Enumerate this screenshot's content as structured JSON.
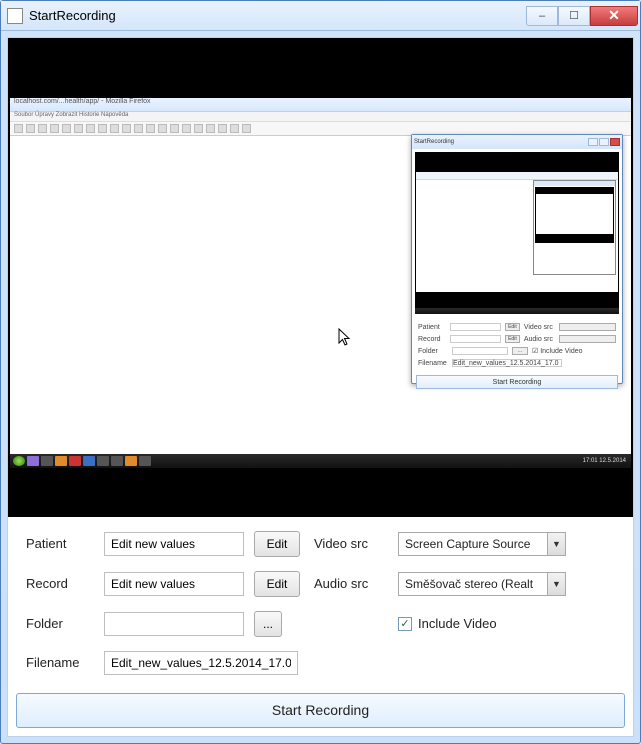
{
  "window": {
    "title": "StartRecording",
    "min_label": "–",
    "max_label": "☐",
    "close_label": "✕"
  },
  "preview": {
    "inner_title": "localhost.com/...health/app/ - Mozilla Firefox",
    "inner_menu": "Soubor  Úpravy  Zobrazit  Historie  Nápověda",
    "taskbar_clock": "17:01\n12.5.2014"
  },
  "nested": {
    "title": "StartRecording",
    "form_rows": [
      {
        "label": "Patient",
        "btn": "Edit",
        "label2": "Video src"
      },
      {
        "label": "Record",
        "btn": "Edit",
        "label2": "Audio src"
      },
      {
        "label": "Folder",
        "btn": "...",
        "label2": "☑ Include Video"
      },
      {
        "label": "Filename",
        "val": "Edit_new_values_12.5.2014_17.0"
      }
    ],
    "start": "Start Recording"
  },
  "form": {
    "labels": {
      "patient": "Patient",
      "record": "Record",
      "folder": "Folder",
      "filename": "Filename",
      "video_src": "Video src",
      "audio_src": "Audio src",
      "include_video": "Include Video"
    },
    "values": {
      "patient": "Edit new values",
      "record": "Edit new values",
      "folder": "",
      "filename": "Edit_new_values_12.5.2014_17.0"
    },
    "buttons": {
      "edit_patient": "Edit",
      "edit_record": "Edit",
      "folder_browse": "..."
    },
    "selects": {
      "video_src": "Screen Capture Source",
      "audio_src": "Směšovač stereo (Realt"
    },
    "include_video_checked": "✓"
  },
  "start_button": "Start Recording"
}
